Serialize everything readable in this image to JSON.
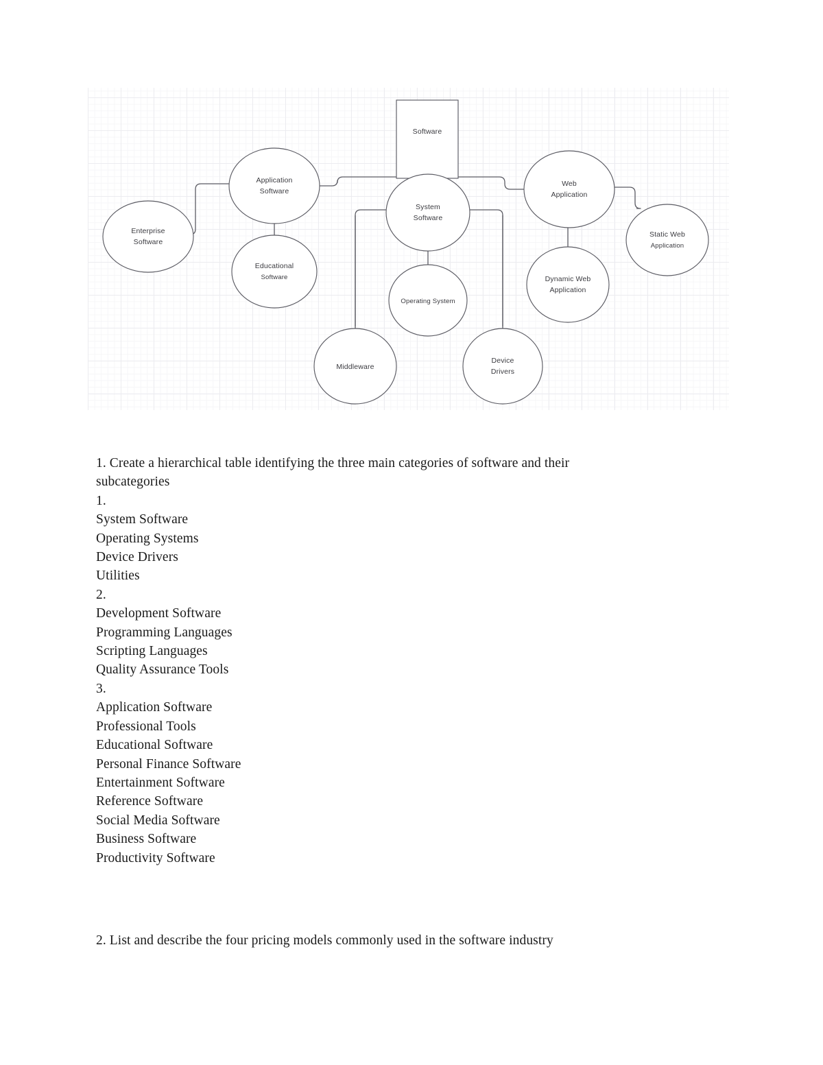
{
  "diagram": {
    "title": "Software categories hierarchy",
    "root": {
      "id": "software",
      "label": "Software",
      "shape": "rect"
    },
    "nodes": [
      {
        "id": "software",
        "label": "Software",
        "shape": "rect",
        "lines": [
          "Software"
        ]
      },
      {
        "id": "application-software",
        "label": "Application Software",
        "shape": "ellipse",
        "lines": [
          "Application",
          "Software"
        ]
      },
      {
        "id": "system-software",
        "label": "System Software",
        "shape": "ellipse",
        "lines": [
          "System",
          "Software"
        ]
      },
      {
        "id": "web-application",
        "label": "Web Application",
        "shape": "ellipse",
        "lines": [
          "Web",
          "Application"
        ]
      },
      {
        "id": "enterprise-software",
        "label": "Enterprise Software",
        "shape": "ellipse",
        "lines": [
          "Enterprise",
          "Software"
        ]
      },
      {
        "id": "educational-software",
        "label": "Educational Software",
        "shape": "ellipse",
        "lines": [
          "Educational",
          "Software"
        ]
      },
      {
        "id": "operating-system",
        "label": "Operating System",
        "shape": "ellipse",
        "lines": [
          "Operating System"
        ]
      },
      {
        "id": "middleware",
        "label": "Middleware",
        "shape": "ellipse",
        "lines": [
          "Middleware"
        ]
      },
      {
        "id": "device-drivers",
        "label": "Device Drivers",
        "shape": "ellipse",
        "lines": [
          "Device",
          "Drivers"
        ]
      },
      {
        "id": "dynamic-web-application",
        "label": "Dynamic Web Application",
        "shape": "ellipse",
        "lines": [
          "Dynamic Web",
          "Application"
        ]
      },
      {
        "id": "static-web-application",
        "label": "Static Web Application",
        "shape": "ellipse",
        "lines": [
          "Static Web",
          "Application"
        ]
      }
    ],
    "edges": [
      {
        "from": "software",
        "to": "application-software"
      },
      {
        "from": "software",
        "to": "system-software"
      },
      {
        "from": "software",
        "to": "web-application"
      },
      {
        "from": "application-software",
        "to": "enterprise-software"
      },
      {
        "from": "application-software",
        "to": "educational-software"
      },
      {
        "from": "system-software",
        "to": "operating-system"
      },
      {
        "from": "system-software",
        "to": "middleware"
      },
      {
        "from": "system-software",
        "to": "device-drivers"
      },
      {
        "from": "web-application",
        "to": "dynamic-web-application"
      },
      {
        "from": "web-application",
        "to": "static-web-application"
      }
    ],
    "colors": {
      "stroke": "#5b5b63",
      "fill": "#ffffff",
      "text": "#3a3a3f",
      "grid_minor": "#f6f6f8",
      "grid_major": "#ececf0"
    }
  },
  "document": {
    "question_1": {
      "prompt": "1. Create a hierarchical table identifying the three main categories of software and their subcategories",
      "lines": [
        "1. Create a hierarchical table identifying the three main categories of software and their",
        "subcategories",
        "1.",
        "System Software",
        "Operating Systems",
        "Device Drivers",
        "Utilities",
        "2.",
        "Development Software",
        "Programming Languages",
        "Scripting Languages",
        "Quality Assurance Tools",
        "3.",
        "Application Software",
        "Professional Tools",
        "Educational Software",
        "Personal Finance Software",
        "Entertainment Software",
        "Reference Software",
        "Social Media Software",
        "Business Software",
        "Productivity Software"
      ]
    },
    "question_2": {
      "text": "2. List and describe the four pricing models commonly used in the software industry"
    }
  }
}
